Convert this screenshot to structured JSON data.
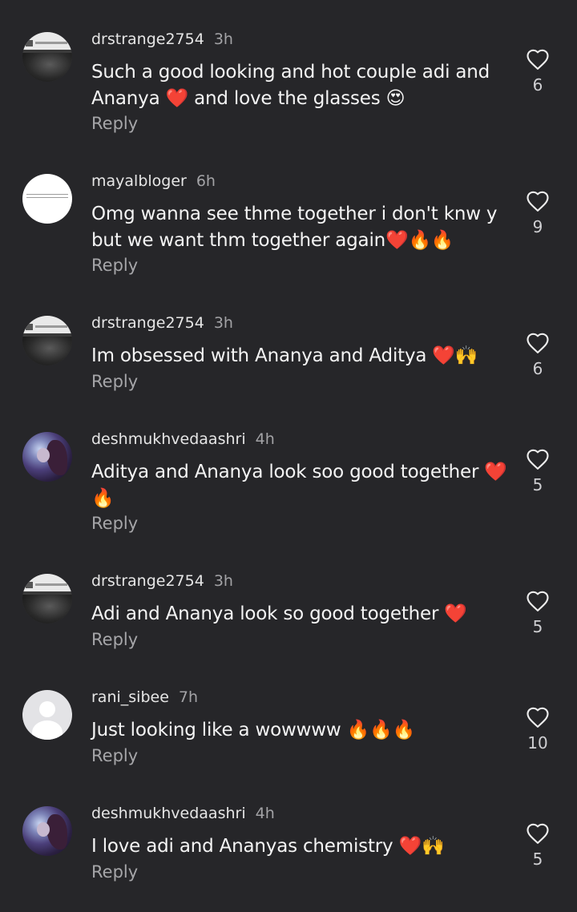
{
  "comments": [
    {
      "username": "drstrange2754",
      "time": "3h",
      "text": "Such a good looking and hot couple adi and Ananya ❤️ and love the glasses 😍",
      "reply_label": "Reply",
      "likes": "6"
    },
    {
      "username": "mayalbloger",
      "time": "6h",
      "text": "Omg wanna see thme together i don't knw y but we want thm together again❤️🔥🔥",
      "reply_label": "Reply",
      "likes": "9"
    },
    {
      "username": "drstrange2754",
      "time": "3h",
      "text": "Im obsessed with Ananya and Aditya ❤️🙌",
      "reply_label": "Reply",
      "likes": "6"
    },
    {
      "username": "deshmukhvedaashri",
      "time": "4h",
      "text": "Aditya and Ananya look soo good together ❤️ 🔥",
      "reply_label": "Reply",
      "likes": "5"
    },
    {
      "username": "drstrange2754",
      "time": "3h",
      "text": "Adi and Ananya look so good together ❤️",
      "reply_label": "Reply",
      "likes": "5"
    },
    {
      "username": "rani_sibee",
      "time": "7h",
      "text": "Just looking like a wowwww 🔥🔥🔥",
      "reply_label": "Reply",
      "likes": "10"
    },
    {
      "username": "deshmukhvedaashri",
      "time": "4h",
      "text": "I love adi and Ananyas chemistry ❤️🙌",
      "reply_label": "Reply",
      "likes": "5"
    }
  ],
  "icons": {
    "like": "heart-outline-icon"
  },
  "colors": {
    "background": "#262629",
    "primary_text": "#f4f4f4",
    "secondary_text": "#a3a3a6"
  }
}
